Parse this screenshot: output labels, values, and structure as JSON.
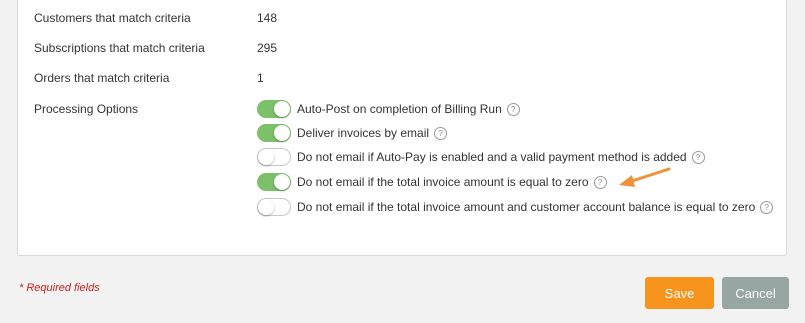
{
  "summary": [
    {
      "label": "Customers that match criteria",
      "value": "148"
    },
    {
      "label": "Subscriptions that match criteria",
      "value": "295"
    },
    {
      "label": "Orders that match criteria",
      "value": "1"
    }
  ],
  "processing": {
    "label": "Processing Options",
    "options": [
      {
        "label": "Auto-Post on completion of Billing Run",
        "enabled": true
      },
      {
        "label": "Deliver invoices by email",
        "enabled": true
      },
      {
        "label": "Do not email if Auto-Pay is enabled and a valid payment method is added",
        "enabled": false
      },
      {
        "label": "Do not email if the total invoice amount is equal to zero",
        "enabled": true
      },
      {
        "label": "Do not email if the total invoice amount and customer account balance is equal to zero",
        "enabled": false
      }
    ],
    "help_glyph": "?"
  },
  "footer": {
    "required_note": "* Required fields",
    "save_label": "Save",
    "cancel_label": "Cancel"
  },
  "colors": {
    "toggle_on": "#7cc06a",
    "save": "#f7941d",
    "cancel": "#97a6a3",
    "required": "#cc1f1f",
    "arrow": "#f0923a"
  }
}
